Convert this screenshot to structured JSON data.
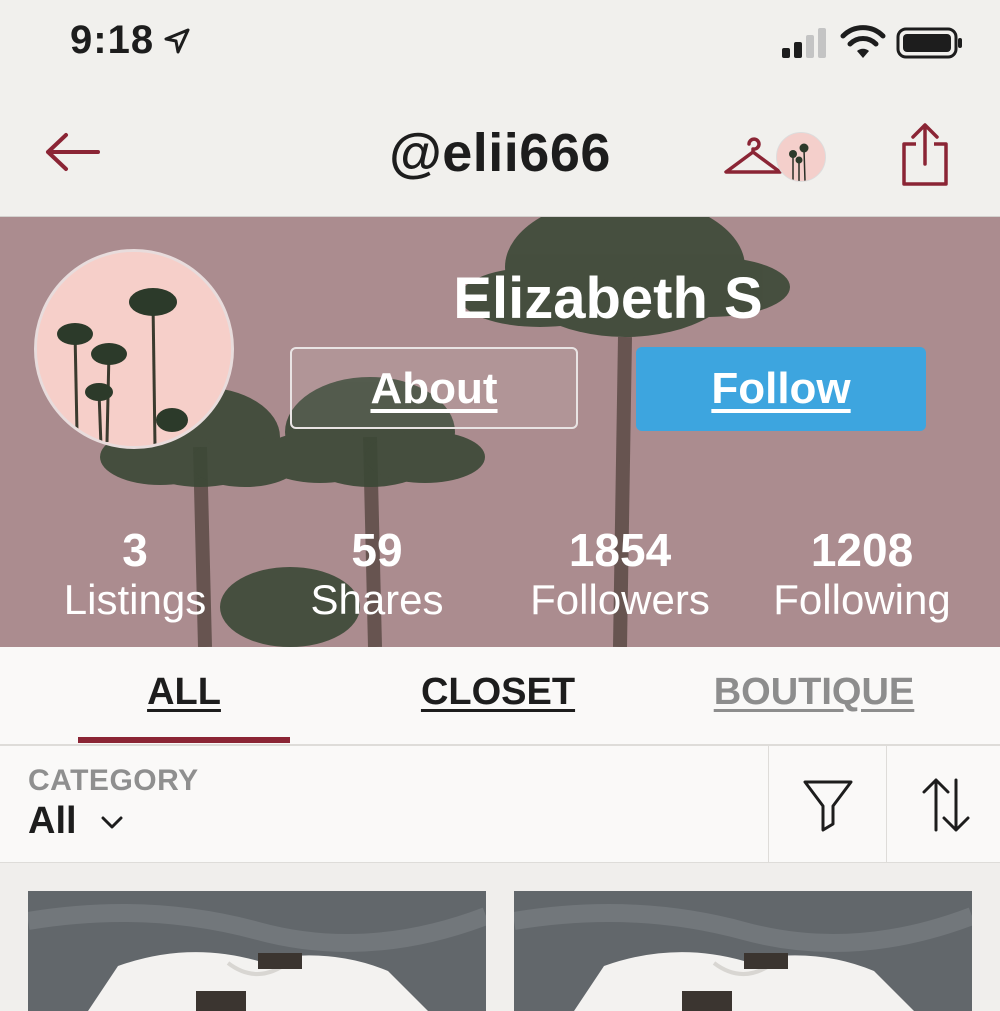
{
  "status_bar": {
    "time": "9:18"
  },
  "header": {
    "handle": "@elii666"
  },
  "profile": {
    "name": "Elizabeth S",
    "about_label": "About",
    "follow_label": "Follow",
    "stats": [
      {
        "value": "3",
        "label": "Listings"
      },
      {
        "value": "59",
        "label": "Shares"
      },
      {
        "value": "1854",
        "label": "Followers"
      },
      {
        "value": "1208",
        "label": "Following"
      }
    ]
  },
  "tabs": [
    {
      "label": "ALL",
      "active": true
    },
    {
      "label": "CLOSET",
      "active": false
    },
    {
      "label": "BOUTIQUE",
      "active": false
    }
  ],
  "filter": {
    "category_label": "CATEGORY",
    "category_value": "All"
  },
  "colors": {
    "accent": "#8b2535",
    "follow": "#3da5df",
    "cover": "#a5878a"
  }
}
